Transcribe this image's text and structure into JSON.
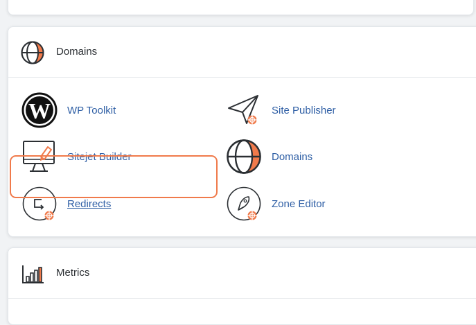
{
  "sections": {
    "domains": {
      "title": "Domains",
      "items": [
        {
          "label": "WP Toolkit",
          "icon": "wordpress-icon"
        },
        {
          "label": "Site Publisher",
          "icon": "site-publisher-icon"
        },
        {
          "label": "Sitejet Builder",
          "icon": "sitejet-builder-icon"
        },
        {
          "label": "Domains",
          "icon": "globe-icon"
        },
        {
          "label": "Redirects",
          "icon": "redirects-icon"
        },
        {
          "label": "Zone Editor",
          "icon": "zone-editor-icon"
        }
      ]
    },
    "metrics": {
      "title": "Metrics",
      "icon": "metrics-icon"
    }
  },
  "highlighted_item": "Redirects",
  "colors": {
    "accent": "#f07a4b",
    "link": "#2f5fa5",
    "icon_stroke": "#2b2f33",
    "panel_bg": "#ffffff",
    "page_bg": "#f1f3f5"
  }
}
